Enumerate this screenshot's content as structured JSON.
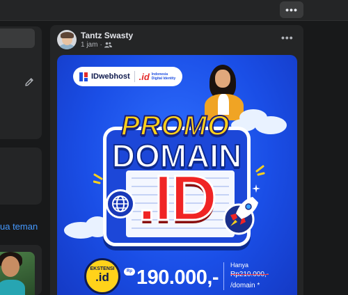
{
  "topbar": {
    "more_icon": "more-horizontal-icon",
    "more_label": "•••"
  },
  "left": {
    "edit_icon": "pencil-icon",
    "link_text": "ua teman"
  },
  "post": {
    "author": "Tantz Swasty",
    "time": "1 jam",
    "separator": "·",
    "audience_icon": "friends-icon",
    "more_label": "•••"
  },
  "banner": {
    "logo_brand": "IDwebhost",
    "logo_id": ".id",
    "logo_tag": "Indonesia Digital Identity",
    "headline_1": "PROMO",
    "headline_2": "DOMAIN",
    "headline_3": ".ID",
    "badge_label": "EKSTENSI",
    "badge_value": ".id",
    "currency": "Rp",
    "price": "190.000,-",
    "only_label": "Hanya",
    "old_price": "Rp210.000,-",
    "per_domain": "/domain *"
  },
  "colors": {
    "page_bg": "#18191a",
    "card_bg": "#242526",
    "banner_blue": "#1a4ee6",
    "promo_yellow": "#ffd21a",
    "id_red": "#f02424",
    "link_blue": "#4599ff"
  }
}
